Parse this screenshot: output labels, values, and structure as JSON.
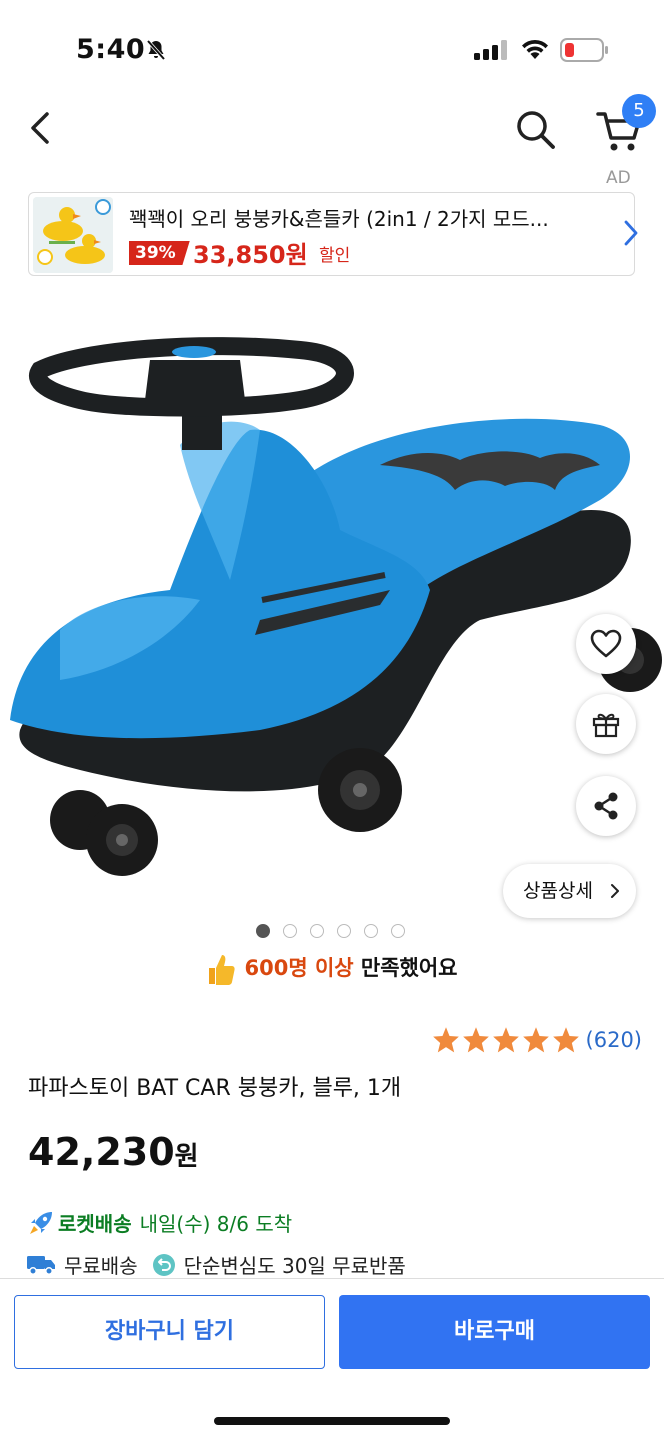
{
  "status_bar": {
    "time": "5:40"
  },
  "nav": {
    "cart_count": "5"
  },
  "ad": {
    "label": "AD",
    "title": "꽥꽥이 오리 붕붕카&흔들카 (2in1 / 2가지 모드...",
    "discount": "39%",
    "price": "33,850원",
    "sale_label": "할인"
  },
  "product": {
    "detail_button": "상품상세",
    "image_count": 6,
    "active_image": 1,
    "satisfaction_highlight": "600명 이상",
    "satisfaction_rest": "만족했어요",
    "rating_stars": 5,
    "rating_count": "(620)",
    "title": "파파스토이 BAT CAR 붕붕카, 블루, 1개",
    "price_number": "42,230",
    "price_unit": "원",
    "rocket_label": "로켓배송",
    "delivery_date": "내일(수) 8/6 도착",
    "free_shipping": "무료배송",
    "free_return": "단순변심도 30일 무료반품"
  },
  "actions": {
    "add_to_cart": "장바구니 담기",
    "buy_now": "바로구매"
  },
  "colors": {
    "accent_blue": "#3173f2",
    "discount_red": "#d6261a",
    "rocket_green": "#0b7d23",
    "star_orange": "#f08a3c"
  },
  "icons": [
    "bell-slash-icon",
    "signal-icon",
    "wifi-icon",
    "battery-icon",
    "back-icon",
    "search-icon",
    "cart-icon",
    "chevron-right-icon",
    "heart-icon",
    "gift-icon",
    "share-icon",
    "thumbs-up-icon",
    "star-icon",
    "rocket-icon",
    "truck-icon",
    "return-icon"
  ]
}
